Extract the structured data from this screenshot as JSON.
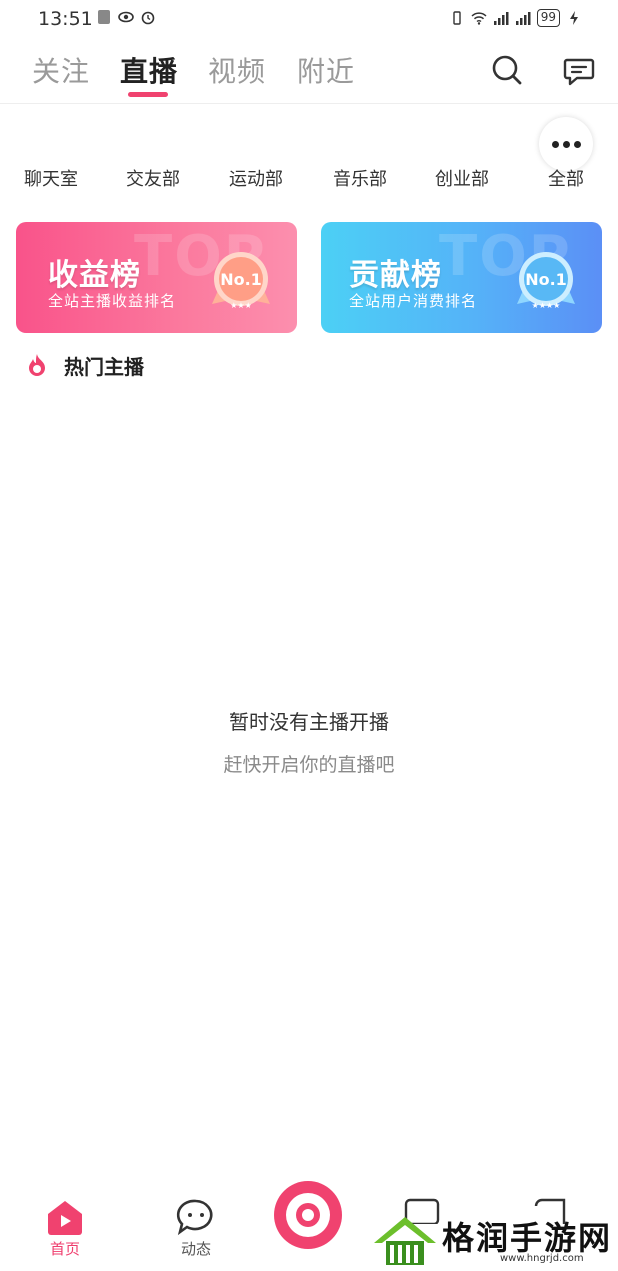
{
  "status_bar": {
    "time": "13:51",
    "battery": "99"
  },
  "top_tabs": {
    "items": [
      {
        "label": "关注",
        "active": false
      },
      {
        "label": "直播",
        "active": true
      },
      {
        "label": "视频",
        "active": false
      },
      {
        "label": "附近",
        "active": false
      }
    ],
    "accent_color": "#f0426f"
  },
  "categories": [
    "聊天室",
    "交友部",
    "运动部",
    "音乐部",
    "创业部",
    "全部"
  ],
  "rank_cards": [
    {
      "title": "收益榜",
      "subtitle": "全站主播收益排名",
      "medal_text": "No.1",
      "bg_text": "TOP",
      "color": "#f9538a"
    },
    {
      "title": "贡献榜",
      "subtitle": "全站用户消费排名",
      "medal_text": "No.1",
      "bg_text": "TOP",
      "color": "#55b2f8"
    }
  ],
  "hot_section": {
    "title": "热门主播",
    "icon": "flame-icon"
  },
  "empty_state": {
    "title": "暂时没有主播开播",
    "subtitle": "赶快开启你的直播吧"
  },
  "bottom_nav": {
    "items": [
      {
        "label": "首页",
        "icon": "home-icon",
        "active": true
      },
      {
        "label": "动态",
        "icon": "chat-bubble-icon",
        "active": false
      }
    ],
    "center_button_icon": "live-camera-icon"
  },
  "watermark": {
    "text": "格润手游网",
    "url": "www.hngrjd.com"
  }
}
